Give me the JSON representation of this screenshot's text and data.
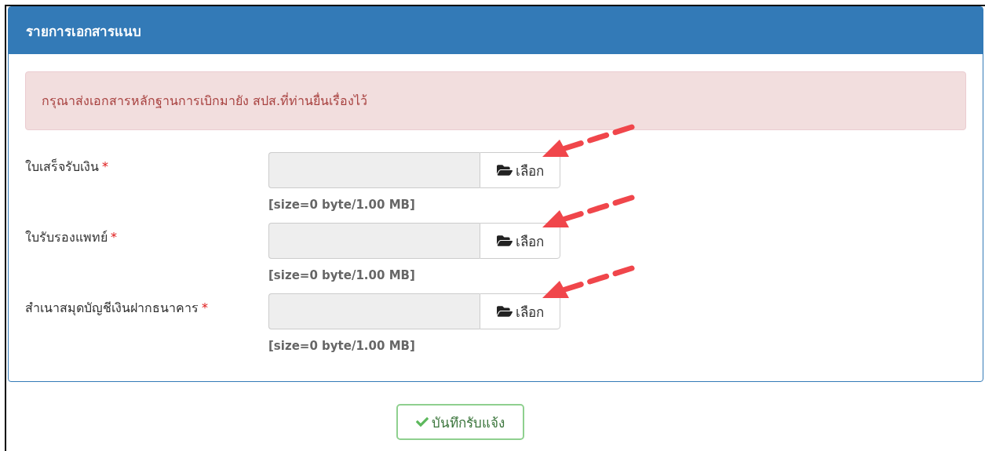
{
  "panel": {
    "title": "รายการเอกสารแนบ"
  },
  "alert": {
    "text": "กรุณาส่งเอกสารหลักฐานการเบิกมายัง สปส.ที่ท่านยื่นเรื่องไว้"
  },
  "fields": [
    {
      "label": "ใบเสร็จรับเงิน",
      "required_mark": "*",
      "button_label": "เลือก",
      "size_text": "[size=0 byte/1.00 MB]",
      "annotated": true
    },
    {
      "label": "ใบรับรองแพทย์",
      "required_mark": "*",
      "button_label": "เลือก",
      "size_text": "[size=0 byte/1.00 MB]",
      "annotated": true
    },
    {
      "label": "สำเนาสมุดบัญชีเงินฝากธนาคาร",
      "required_mark": "*",
      "button_label": "เลือก",
      "size_text": "[size=0 byte/1.00 MB]",
      "annotated": true
    }
  ],
  "submit_button": {
    "label": "บันทึกรับแจ้ง"
  }
}
